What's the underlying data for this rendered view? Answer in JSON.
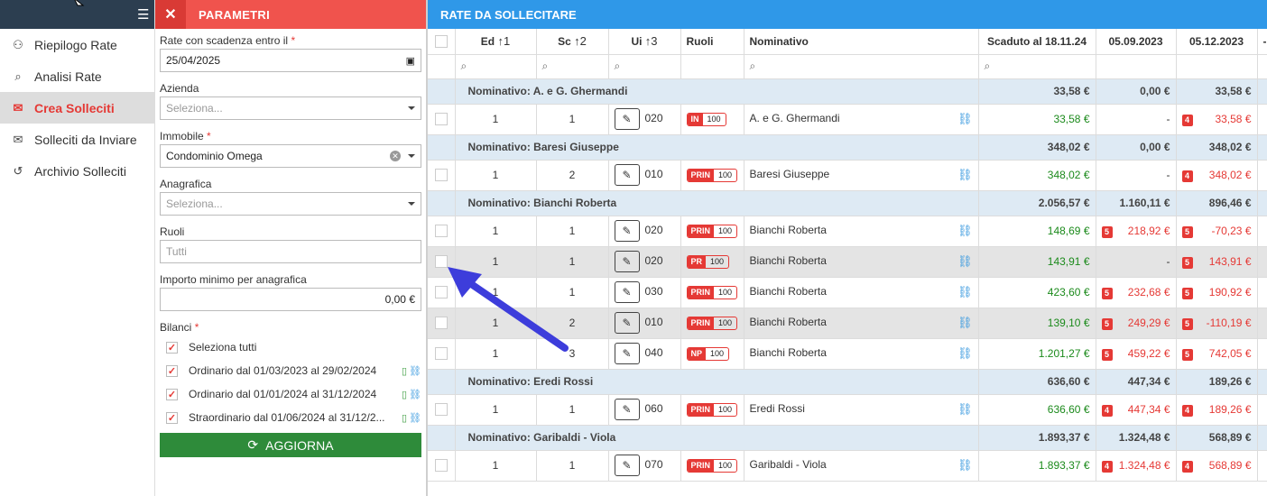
{
  "nav": {
    "items": [
      {
        "label": "Riepilogo Rate",
        "icon": "user-money-icon",
        "active": false
      },
      {
        "label": "Analisi Rate",
        "icon": "analysis-icon",
        "active": false
      },
      {
        "label": "Crea Solleciti",
        "icon": "create-reminder-icon",
        "active": true
      },
      {
        "label": "Solleciti da Inviare",
        "icon": "send-reminder-icon",
        "active": false
      },
      {
        "label": "Archivio Solleciti",
        "icon": "history-icon",
        "active": false
      }
    ]
  },
  "params": {
    "title": "PARAMETRI",
    "scadenza_label": "Rate con scadenza entro il",
    "scadenza_value": "25/04/2025",
    "azienda_label": "Azienda",
    "azienda_placeholder": "Seleziona...",
    "immobile_label": "Immobile",
    "immobile_value": "Condominio Omega",
    "anagrafica_label": "Anagrafica",
    "anagrafica_placeholder": "Seleziona...",
    "ruoli_label": "Ruoli",
    "ruoli_placeholder": "Tutti",
    "importo_label": "Importo minimo per anagrafica",
    "importo_value": "0,00 €",
    "bilanci_label": "Bilanci",
    "select_all": "Seleziona tutti",
    "bilanci": [
      "Ordinario dal 01/03/2023 al 29/02/2024",
      "Ordinario dal 01/01/2024 al 31/12/2024",
      "Straordinario dal 01/06/2024 al 31/12/2..."
    ],
    "refresh_label": "AGGIORNA",
    "required_mark": "*"
  },
  "rate": {
    "title": "RATE DA SOLLECITARE",
    "headers": {
      "ed": "Ed",
      "ed_sort": "↑1",
      "sc": "Sc",
      "sc_sort": "↑2",
      "ui": "Ui",
      "ui_sort": "↑3",
      "ruoli": "Ruoli",
      "nominativo": "Nominativo",
      "scaduto": "Scaduto al 18.11.24",
      "d1": "05.09.2023",
      "d2": "05.12.2023",
      "d3": "-"
    },
    "rows": [
      {
        "type": "group",
        "label": "Nominativo: A. e G. Ghermandi",
        "scaduto": "33,58 €",
        "d1": "0,00 €",
        "d2": "33,58 €"
      },
      {
        "type": "row",
        "ed": "1",
        "sc": "1",
        "ui": "020",
        "role": "IN",
        "role_n": "100",
        "nome": "A. e G. Ghermandi",
        "scaduto": "33,58 €",
        "d1": "-",
        "d1b": "",
        "d2": "33,58 €",
        "d2b": "4"
      },
      {
        "type": "group",
        "label": "Nominativo: Baresi Giuseppe",
        "scaduto": "348,02 €",
        "d1": "0,00 €",
        "d2": "348,02 €"
      },
      {
        "type": "row",
        "ed": "1",
        "sc": "2",
        "ui": "010",
        "role": "PRIN",
        "role_n": "100",
        "nome": "Baresi Giuseppe",
        "scaduto": "348,02 €",
        "d1": "-",
        "d1b": "",
        "d2": "348,02 €",
        "d2b": "4"
      },
      {
        "type": "group",
        "label": "Nominativo: Bianchi Roberta",
        "scaduto": "2.056,57 €",
        "d1": "1.160,11 €",
        "d2": "896,46 €"
      },
      {
        "type": "row",
        "ed": "1",
        "sc": "1",
        "ui": "020",
        "role": "PRIN",
        "role_n": "100",
        "nome": "Bianchi Roberta",
        "scaduto": "148,69 €",
        "d1": "218,92 €",
        "d1b": "5",
        "d2": "-70,23 €",
        "d2b": "5"
      },
      {
        "type": "row",
        "sel": true,
        "ed": "1",
        "sc": "1",
        "ui": "020",
        "role": "PR",
        "role_n": "100",
        "nome": "Bianchi Roberta",
        "scaduto": "143,91 €",
        "d1": "-",
        "d1b": "",
        "d2": "143,91 €",
        "d2b": "5"
      },
      {
        "type": "row",
        "ed": "1",
        "sc": "1",
        "ui": "030",
        "role": "PRIN",
        "role_n": "100",
        "nome": "Bianchi Roberta",
        "scaduto": "423,60 €",
        "d1": "232,68 €",
        "d1b": "5",
        "d2": "190,92 €",
        "d2b": "5"
      },
      {
        "type": "row",
        "sel": true,
        "ed": "1",
        "sc": "2",
        "ui": "010",
        "role": "PRIN",
        "role_n": "100",
        "nome": "Bianchi Roberta",
        "scaduto": "139,10 €",
        "d1": "249,29 €",
        "d1b": "5",
        "d2": "-110,19 €",
        "d2b": "5"
      },
      {
        "type": "row",
        "ed": "1",
        "sc": "3",
        "ui": "040",
        "role": "NP",
        "role_n": "100",
        "nome": "Bianchi Roberta",
        "scaduto": "1.201,27 €",
        "d1": "459,22 €",
        "d1b": "5",
        "d2": "742,05 €",
        "d2b": "5"
      },
      {
        "type": "group",
        "label": "Nominativo: Eredi Rossi",
        "scaduto": "636,60 €",
        "d1": "447,34 €",
        "d2": "189,26 €"
      },
      {
        "type": "row",
        "ed": "1",
        "sc": "1",
        "ui": "060",
        "role": "PRIN",
        "role_n": "100",
        "nome": "Eredi Rossi",
        "scaduto": "636,60 €",
        "d1": "447,34 €",
        "d1b": "4",
        "d2": "189,26 €",
        "d2b": "4"
      },
      {
        "type": "group",
        "label": "Nominativo: Garibaldi - Viola",
        "scaduto": "1.893,37 €",
        "d1": "1.324,48 €",
        "d2": "568,89 €"
      },
      {
        "type": "row",
        "ed": "1",
        "sc": "1",
        "ui": "070",
        "role": "PRIN",
        "role_n": "100",
        "nome": "Garibaldi - Viola",
        "scaduto": "1.893,37 €",
        "d1": "1.324,48 €",
        "d1b": "4",
        "d2": "568,89 €",
        "d2b": "4"
      }
    ]
  },
  "colors": {
    "accent": "#f0534d",
    "header_blue": "#2f98e8",
    "group_bg": "#deeaf4",
    "green_button": "#2e8b3a",
    "annotation_arrow": "#3d3ddb"
  }
}
